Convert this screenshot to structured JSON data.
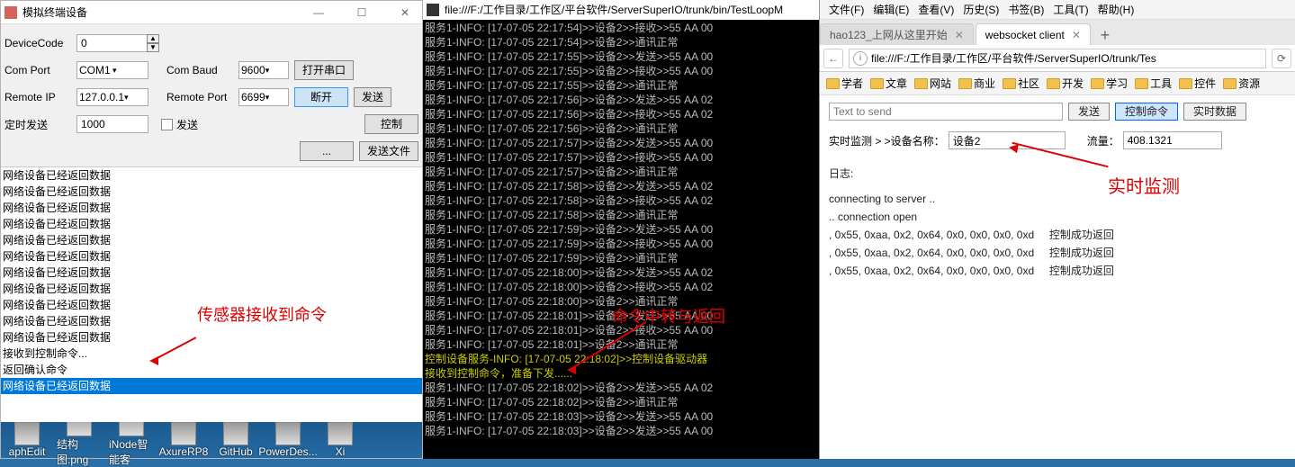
{
  "win": {
    "title": "模拟终端设备",
    "labels": {
      "code": "DeviceCode",
      "port": "Com Port",
      "baud": "Com Baud",
      "rip": "Remote IP",
      "rport": "Remote Port",
      "timer": "定时发送",
      "sendchk": "发送"
    },
    "vals": {
      "code": "0",
      "port": "COM1",
      "baud": "9600",
      "rip": "127.0.0.1",
      "rport": "6699",
      "timer": "1000"
    },
    "btns": {
      "open": "打开串口",
      "disconnect": "断开",
      "send": "发送",
      "ctrl": "控制",
      "browse": "...",
      "sendfile": "发送文件"
    },
    "list": [
      "网络设备已经返回数据",
      "网络设备已经返回数据",
      "网络设备已经返回数据",
      "网络设备已经返回数据",
      "网络设备已经返回数据",
      "网络设备已经返回数据",
      "网络设备已经返回数据",
      "网络设备已经返回数据",
      "网络设备已经返回数据",
      "网络设备已经返回数据",
      "网络设备已经返回数据",
      "接收到控制命令...",
      "返回确认命令",
      "网络设备已经返回数据"
    ],
    "highlight_index": 13,
    "annotation": "传感器接收到命令",
    "task_icons": [
      "aphEdit",
      "结构图.png",
      "iNode智能客",
      "AxureRP8",
      "GitHub",
      "PowerDes...",
      "Xi"
    ]
  },
  "console": {
    "title": "file:///F:/工作目录/工作区/平台软件/ServerSuperIO/trunk/bin/TestLoopM",
    "lines": [
      "服务1-INFO: [17-07-05 22:17:54]>>设备2>>接收>>55 AA 00",
      "服务1-INFO: [17-07-05 22:17:54]>>设备2>>通讯正常",
      "服务1-INFO: [17-07-05 22:17:55]>>设备2>>发送>>55 AA 00",
      "服务1-INFO: [17-07-05 22:17:55]>>设备2>>接收>>55 AA 00",
      "服务1-INFO: [17-07-05 22:17:55]>>设备2>>通讯正常",
      "服务1-INFO: [17-07-05 22:17:56]>>设备2>>发送>>55 AA 02",
      "服务1-INFO: [17-07-05 22:17:56]>>设备2>>接收>>55 AA 02",
      "服务1-INFO: [17-07-05 22:17:56]>>设备2>>通讯正常",
      "服务1-INFO: [17-07-05 22:17:57]>>设备2>>发送>>55 AA 00",
      "服务1-INFO: [17-07-05 22:17:57]>>设备2>>接收>>55 AA 00",
      "服务1-INFO: [17-07-05 22:17:57]>>设备2>>通讯正常",
      "服务1-INFO: [17-07-05 22:17:58]>>设备2>>发送>>55 AA 02",
      "服务1-INFO: [17-07-05 22:17:58]>>设备2>>接收>>55 AA 02",
      "服务1-INFO: [17-07-05 22:17:58]>>设备2>>通讯正常",
      "服务1-INFO: [17-07-05 22:17:59]>>设备2>>发送>>55 AA 00",
      "服务1-INFO: [17-07-05 22:17:59]>>设备2>>接收>>55 AA 00",
      "服务1-INFO: [17-07-05 22:17:59]>>设备2>>通讯正常",
      "服务1-INFO: [17-07-05 22:18:00]>>设备2>>发送>>55 AA 02",
      "服务1-INFO: [17-07-05 22:18:00]>>设备2>>接收>>55 AA 02",
      "服务1-INFO: [17-07-05 22:18:00]>>设备2>>通讯正常",
      "服务1-INFO: [17-07-05 22:18:01]>>设备2>>发送>>55 AA 00",
      "服务1-INFO: [17-07-05 22:18:01]>>设备2>>接收>>55 AA 00",
      "服务1-INFO: [17-07-05 22:18:01]>>设备2>>通讯正常",
      "控制设备服务-INFO: [17-07-05 22:18:02]>>控制设备驱动器",
      "接收到控制命令，准备下发......",
      "服务1-INFO: [17-07-05 22:18:02]>>设备2>>发送>>55 AA 02",
      "服务1-INFO: [17-07-05 22:18:02]>>设备2>>通讯正常",
      "服务1-INFO: [17-07-05 22:18:03]>>设备2>>发送>>55 AA 00",
      "服务1-INFO: [17-07-05 22:18:03]>>设备2>>发送>>55 AA 00"
    ],
    "yellow_idx": [
      23,
      24
    ],
    "annotation": "命令中转与返回"
  },
  "browser": {
    "menus": [
      "文件(F)",
      "编辑(E)",
      "查看(V)",
      "历史(S)",
      "书签(B)",
      "工具(T)",
      "帮助(H)"
    ],
    "tabs": [
      {
        "label": "hao123_上网从这里开始",
        "active": false
      },
      {
        "label": "websocket client",
        "active": true
      }
    ],
    "url": "file:///F:/工作目录/工作区/平台软件/ServerSuperIO/trunk/Tes",
    "bookmarks": [
      "学者",
      "文章",
      "网站",
      "商业",
      "社区",
      "开发",
      "学习",
      "工具",
      "控件",
      "资源"
    ],
    "input_placeholder": "Text to send",
    "btns": {
      "send": "发送",
      "ctrl": "控制命令",
      "rt": "实时数据"
    },
    "monitor": {
      "prefix": "实时监测 > >设备名称：",
      "device": "设备2",
      "flow_label": "流量：",
      "flow": "408.1321"
    },
    "log_title": "日志:",
    "log": [
      "connecting to server ..",
      ".. connection open",
      ", 0x55, 0xaa, 0x2, 0x64, 0x0, 0x0, 0x0, 0xd     控制成功返回",
      ", 0x55, 0xaa, 0x2, 0x64, 0x0, 0x0, 0x0, 0xd     控制成功返回",
      ", 0x55, 0xaa, 0x2, 0x64, 0x0, 0x0, 0x0, 0xd     控制成功返回"
    ],
    "annotation": "实时监测"
  }
}
